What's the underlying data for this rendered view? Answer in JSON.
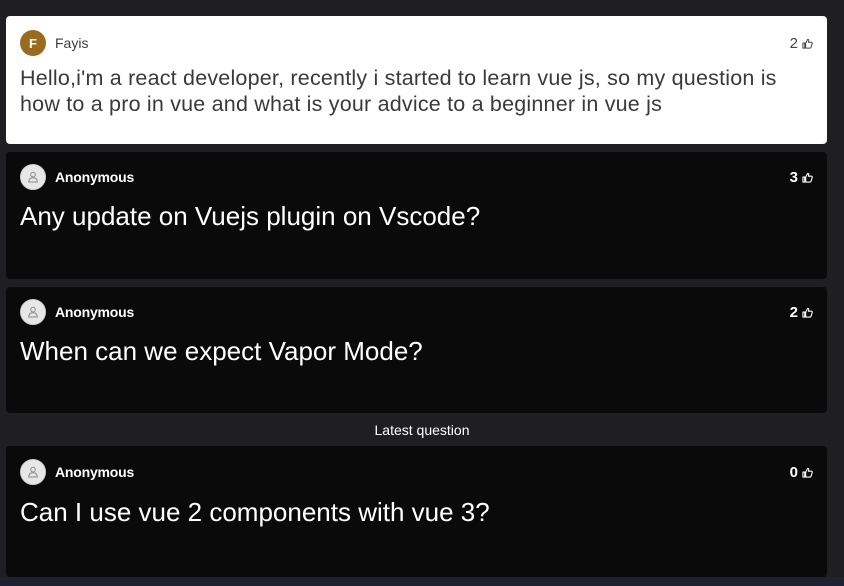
{
  "questions": [
    {
      "author": "Fayis",
      "avatar_letter": "F",
      "likes": "2",
      "text": "Hello,i'm a react developer, recently i started to learn vue js, so my question is how to a pro in vue and what is your advice to a beginner in vue js",
      "highlighted": true,
      "accent": "#9a6a1e"
    },
    {
      "author": "Anonymous",
      "likes": "3",
      "text": "Any update on Vuejs plugin on Vscode?"
    },
    {
      "author": "Anonymous",
      "likes": "2",
      "text": "When can we expect Vapor Mode?"
    },
    {
      "author": "Anonymous",
      "likes": "0",
      "text": "Can I use vue 2 components with vue 3?"
    }
  ],
  "latest_label": "Latest question",
  "icons": {
    "like": "thumbs-up-icon",
    "anonymous": "user-icon"
  }
}
